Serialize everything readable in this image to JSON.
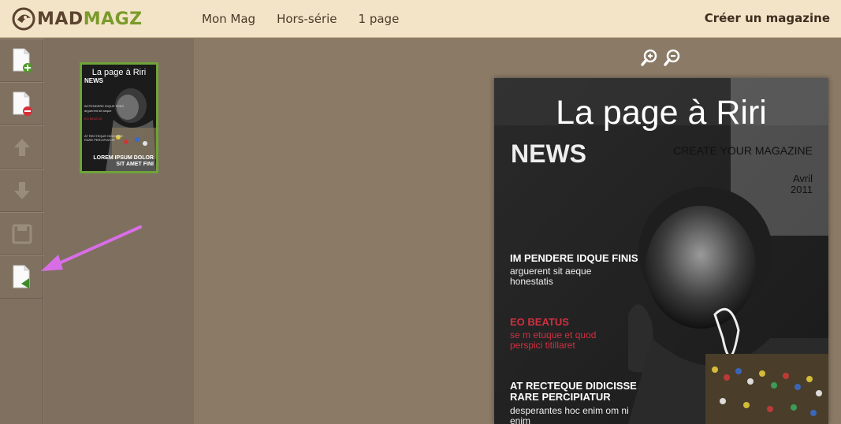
{
  "brand": {
    "mad": "MAD",
    "magz": "MAGZ"
  },
  "nav": {
    "items": [
      "Mon Mag",
      "Hors-série",
      "1 page"
    ],
    "create": "Créer un magazine"
  },
  "toolbar": {
    "tools": [
      "add-page",
      "delete-page",
      "move-up",
      "move-down",
      "save",
      "export"
    ]
  },
  "thumbnail": {
    "title": "La page à Riri",
    "news": "NEWS",
    "lines": [
      "IM PENDERE IDQUE FINIS",
      "arguerent sit aeque",
      "EO BEATUS",
      "AT RECTEQUE DIDICISSE",
      "RARE PERCIPIATUR"
    ],
    "bottom1": "LOREM IPSUM DOLOR",
    "bottom2": "SIT AMET FINI"
  },
  "page": {
    "title": "La page à Riri",
    "news": "NEWS",
    "create": "CREATE YOUR MAGAZINE",
    "date1": "Avril",
    "date2": "2011",
    "h1": "IM PENDERE IDQUE FINIS",
    "s1a": "arguerent sit aeque",
    "s1b": "honestatis",
    "h2": "EO BEATUS",
    "s2a": "se m etuque et quod",
    "s2b": "perspici titillaret",
    "h3a": "AT RECTEQUE DIDICISSE",
    "h3b": "RARE PERCIPIATUR",
    "s3a": "desperantes hoc enim om ni",
    "s3b": "enim"
  },
  "colors": {
    "accent_green": "#6ea43a",
    "arrow": "#d86ee6",
    "bar": "#f3e4c8"
  }
}
